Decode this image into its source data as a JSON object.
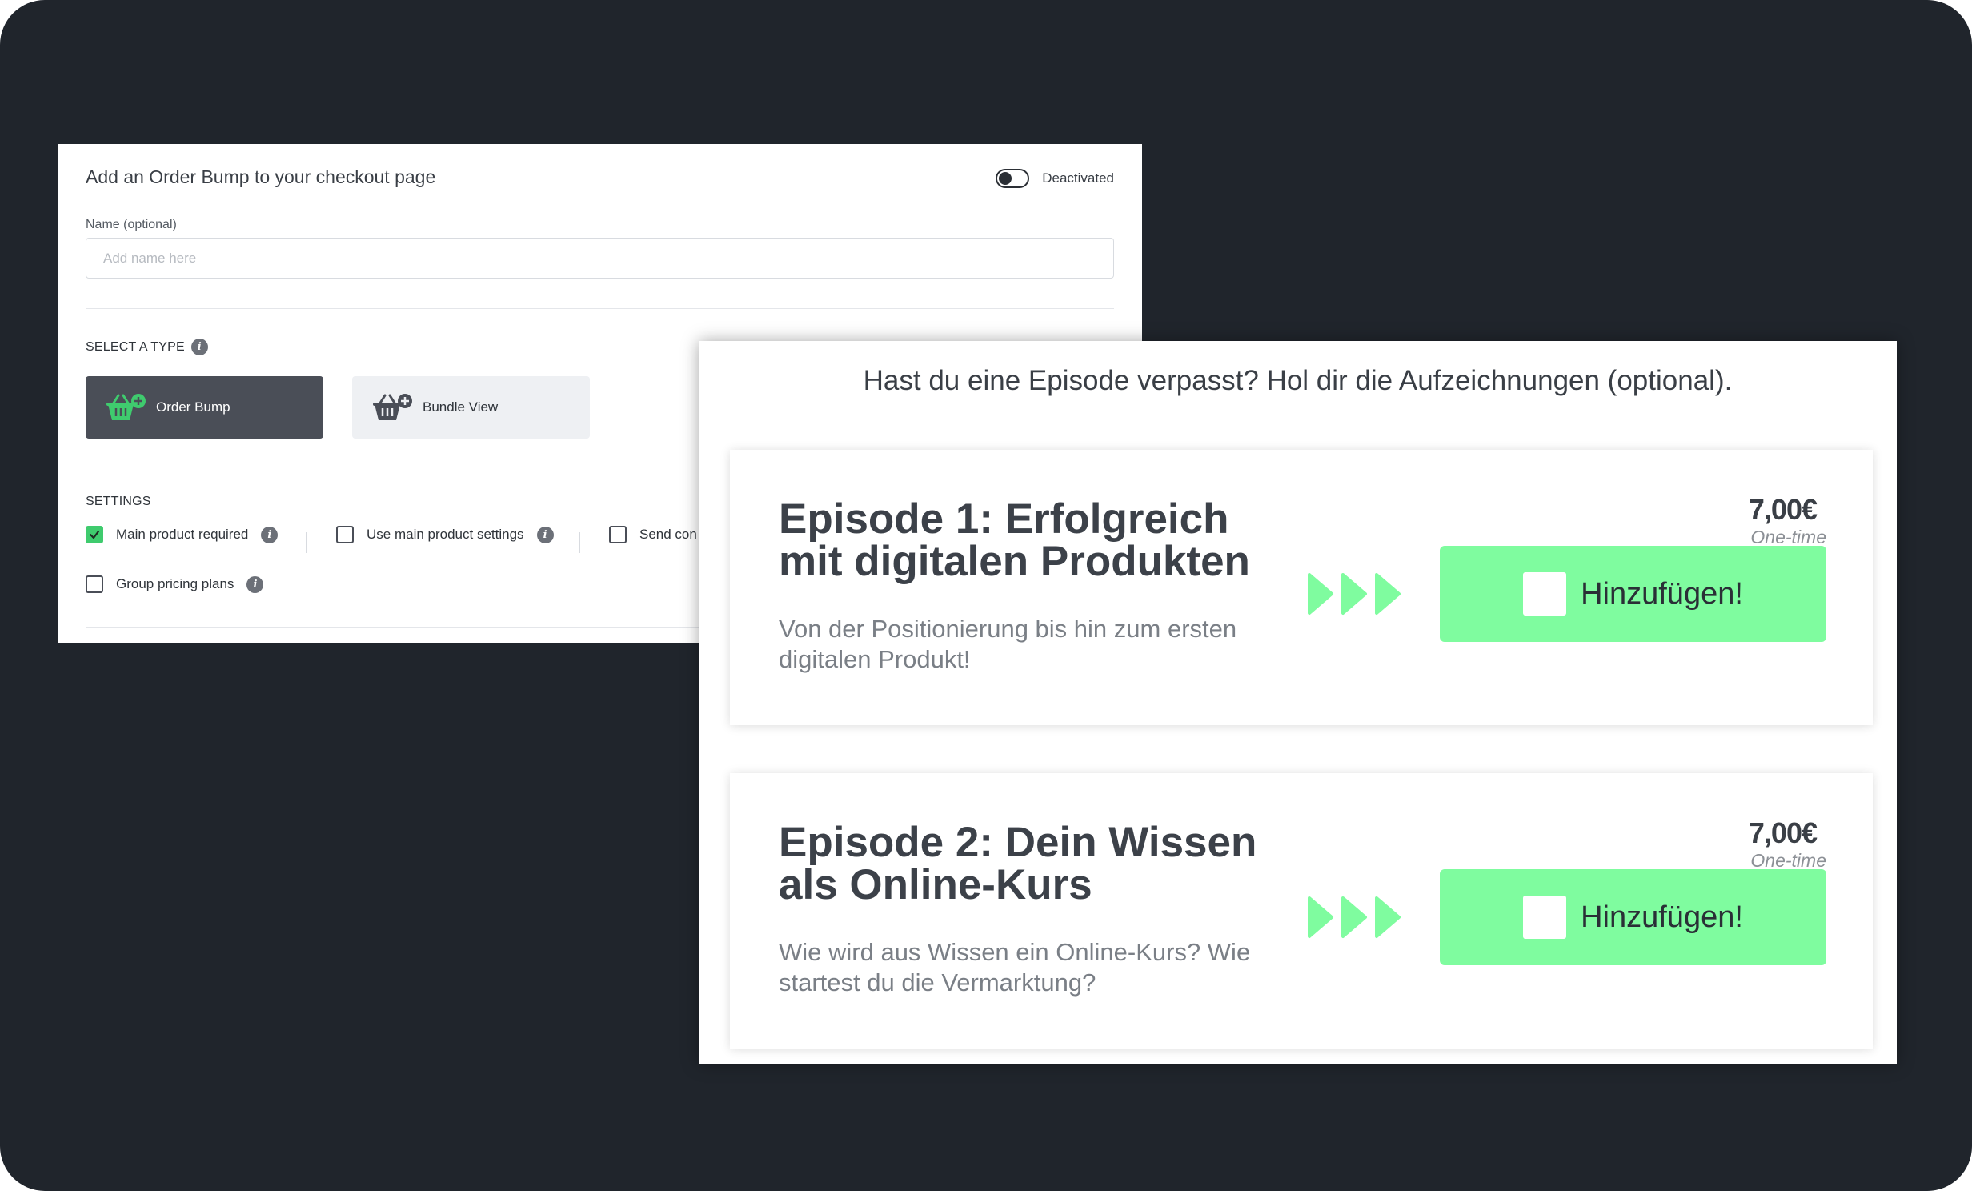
{
  "settings": {
    "title": "Add an Order Bump to your checkout page",
    "toggle_label": "Deactivated",
    "name_label": "Name (optional)",
    "name_placeholder": "Add name here",
    "name_value": "",
    "type_section_label": "SELECT A TYPE",
    "types": [
      {
        "label": "Order Bump",
        "selected": true
      },
      {
        "label": "Bundle View",
        "selected": false
      }
    ],
    "settings_section_label": "SETTINGS",
    "options": [
      {
        "label": "Main product required",
        "checked": true
      },
      {
        "label": "Use main product settings",
        "checked": false
      },
      {
        "label": "Send con",
        "checked": false
      },
      {
        "label": "Group pricing plans",
        "checked": false
      }
    ]
  },
  "preview": {
    "heading": "Hast du eine Episode verpasst? Hol dir die Aufzeichnungen (optional).",
    "episodes": [
      {
        "title": "Episode 1: Erfolgreich mit digitalen Produkten",
        "description": "Von der Positionierung bis hin zum ersten digitalen Produkt!",
        "price": "7,00€",
        "recurrence": "One-time",
        "button_label": "Hinzufügen!"
      },
      {
        "title": "Episode 2: Dein Wissen als Online-Kurs",
        "description": "Wie wird aus Wissen ein Online-Kurs? Wie startest du die Vermarktung?",
        "price": "7,00€",
        "recurrence": "One-time",
        "button_label": "Hinzufügen!"
      }
    ]
  },
  "colors": {
    "background": "#20252c",
    "accent_green": "#7ffc9f",
    "check_green": "#3fcb6e",
    "selected_card": "#4a4e57"
  }
}
